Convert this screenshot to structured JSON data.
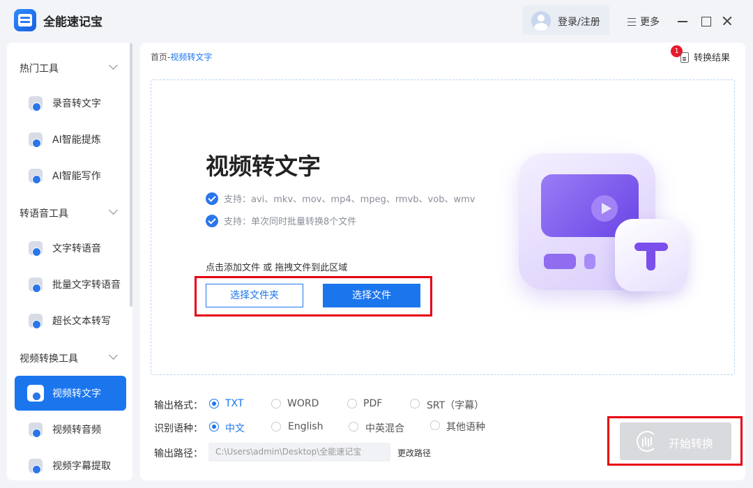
{
  "app": {
    "title": "全能速记宝"
  },
  "titlebar": {
    "login": "登录/注册",
    "more": "更多"
  },
  "sidebar": {
    "groups": [
      {
        "label": "热门工具"
      },
      {
        "label": "转语音工具"
      },
      {
        "label": "视频转换工具"
      }
    ],
    "items": [
      {
        "label": "录音转文字"
      },
      {
        "label": "AI智能提炼"
      },
      {
        "label": "AI智能写作"
      },
      {
        "label": "文字转语音"
      },
      {
        "label": "批量文字转语音"
      },
      {
        "label": "超长文本转写"
      },
      {
        "label": "视频转文字",
        "active": true
      },
      {
        "label": "视频转音频"
      },
      {
        "label": "视频字幕提取"
      }
    ]
  },
  "breadcrumb": {
    "home": "首页",
    "sep": "-",
    "current": "视频转文字"
  },
  "results": {
    "label": "转换结果",
    "badge": "1"
  },
  "hero": {
    "title": "视频转文字",
    "features": [
      "支持：avi、mkv、mov、mp4、mpeg、rmvb、vob、wmv",
      "支持：单次同时批量转换8个文件"
    ],
    "hint": "点击添加文件 或 拖拽文件到此区域",
    "btn_folder": "选择文件夹",
    "btn_file": "选择文件"
  },
  "options": {
    "format_label": "输出格式：",
    "formats": [
      "TXT",
      "WORD",
      "PDF",
      "SRT（字幕）"
    ],
    "format_selected": "TXT",
    "lang_label": "识别语种：",
    "langs": [
      "中文",
      "English",
      "中英混合",
      "其他语种"
    ],
    "lang_selected": "中文",
    "path_label": "输出路径：",
    "path_value": "C:\\Users\\admin\\Desktop\\全能速记宝",
    "change_path": "更改路径"
  },
  "start": {
    "label": "开始转换"
  },
  "colors": {
    "accent": "#1b76ee",
    "highlight": "#e60012",
    "illustration": "#7a4fec"
  }
}
